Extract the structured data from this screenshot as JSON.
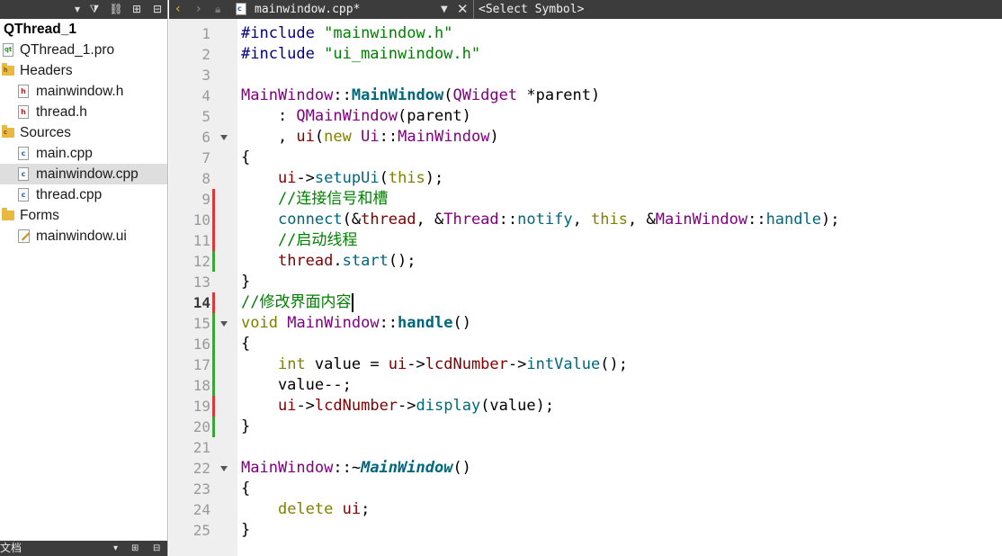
{
  "project_tree": {
    "root": "QThread_1",
    "pro_file": "QThread_1.pro",
    "headers_folder": "Headers",
    "headers": [
      "mainwindow.h",
      "thread.h"
    ],
    "sources_folder": "Sources",
    "sources": [
      "main.cpp",
      "mainwindow.cpp",
      "thread.cpp"
    ],
    "forms_folder": "Forms",
    "forms": [
      "mainwindow.ui"
    ]
  },
  "bottom_panel": {
    "title": "文档"
  },
  "editor_toolbar": {
    "file_tab": "mainwindow.cpp*",
    "symbol_selector": "<Select Symbol>"
  },
  "editor": {
    "current_line": 14,
    "line_numbers": [
      "1",
      "2",
      "3",
      "4",
      "5",
      "6",
      "7",
      "8",
      "9",
      "10",
      "11",
      "12",
      "13",
      "14",
      "15",
      "16",
      "17",
      "18",
      "19",
      "20",
      "21",
      "22",
      "23",
      "24",
      "25"
    ],
    "lines": [
      [
        {
          "t": "#include ",
          "c": "pp"
        },
        {
          "t": "\"mainwindow.h\"",
          "c": "str"
        }
      ],
      [
        {
          "t": "#include ",
          "c": "pp"
        },
        {
          "t": "\"ui_mainwindow.h\"",
          "c": "str"
        }
      ],
      [],
      [
        {
          "t": "MainWindow",
          "c": "cls"
        },
        {
          "t": "::",
          "c": "pl"
        },
        {
          "t": "MainWindow",
          "c": "fdef"
        },
        {
          "t": "(",
          "c": "pl"
        },
        {
          "t": "QWidget",
          "c": "cls"
        },
        {
          "t": " *",
          "c": "pl"
        },
        {
          "t": "parent",
          "c": "pl"
        },
        {
          "t": ")",
          "c": "pl"
        }
      ],
      [
        {
          "t": "    : ",
          "c": "pl"
        },
        {
          "t": "QMainWindow",
          "c": "cls"
        },
        {
          "t": "(parent)",
          "c": "pl"
        }
      ],
      [
        {
          "t": "    , ",
          "c": "pl"
        },
        {
          "t": "ui",
          "c": "mem"
        },
        {
          "t": "(",
          "c": "pl"
        },
        {
          "t": "new",
          "c": "kw"
        },
        {
          "t": " ",
          "c": "pl"
        },
        {
          "t": "Ui",
          "c": "cls"
        },
        {
          "t": "::",
          "c": "pl"
        },
        {
          "t": "MainWindow",
          "c": "cls"
        },
        {
          "t": ")",
          "c": "pl"
        }
      ],
      [
        {
          "t": "{",
          "c": "pl"
        }
      ],
      [
        {
          "t": "    ",
          "c": "pl"
        },
        {
          "t": "ui",
          "c": "mem"
        },
        {
          "t": "->",
          "c": "pl"
        },
        {
          "t": "setupUi",
          "c": "fn"
        },
        {
          "t": "(",
          "c": "pl"
        },
        {
          "t": "this",
          "c": "kw"
        },
        {
          "t": ");",
          "c": "pl"
        }
      ],
      [
        {
          "t": "    //",
          "c": "cmt"
        },
        {
          "t": "连接信号和槽",
          "c": "cmt",
          "cjk": true
        }
      ],
      [
        {
          "t": "    ",
          "c": "pl"
        },
        {
          "t": "connect",
          "c": "fn"
        },
        {
          "t": "(&",
          "c": "pl"
        },
        {
          "t": "thread",
          "c": "mem"
        },
        {
          "t": ", &",
          "c": "pl"
        },
        {
          "t": "Thread",
          "c": "cls"
        },
        {
          "t": "::",
          "c": "pl"
        },
        {
          "t": "notify",
          "c": "fn"
        },
        {
          "t": ", ",
          "c": "pl"
        },
        {
          "t": "this",
          "c": "kw"
        },
        {
          "t": ", &",
          "c": "pl"
        },
        {
          "t": "MainWindow",
          "c": "cls"
        },
        {
          "t": "::",
          "c": "pl"
        },
        {
          "t": "handle",
          "c": "fn"
        },
        {
          "t": ");",
          "c": "pl"
        }
      ],
      [
        {
          "t": "    //",
          "c": "cmt"
        },
        {
          "t": "启动线程",
          "c": "cmt",
          "cjk": true
        }
      ],
      [
        {
          "t": "    ",
          "c": "pl"
        },
        {
          "t": "thread",
          "c": "mem"
        },
        {
          "t": ".",
          "c": "pl"
        },
        {
          "t": "start",
          "c": "fn"
        },
        {
          "t": "();",
          "c": "pl"
        }
      ],
      [
        {
          "t": "}",
          "c": "pl"
        }
      ],
      [
        {
          "t": "//",
          "c": "cmt"
        },
        {
          "t": "修改界面内容",
          "c": "cmt",
          "cjk": true
        }
      ],
      [
        {
          "t": "void",
          "c": "kw"
        },
        {
          "t": " ",
          "c": "pl"
        },
        {
          "t": "MainWindow",
          "c": "cls"
        },
        {
          "t": "::",
          "c": "pl"
        },
        {
          "t": "handle",
          "c": "fdef"
        },
        {
          "t": "()",
          "c": "pl"
        }
      ],
      [
        {
          "t": "{",
          "c": "pl"
        }
      ],
      [
        {
          "t": "    ",
          "c": "pl"
        },
        {
          "t": "int",
          "c": "kw"
        },
        {
          "t": " value = ",
          "c": "pl"
        },
        {
          "t": "ui",
          "c": "mem"
        },
        {
          "t": "->",
          "c": "pl"
        },
        {
          "t": "lcdNumber",
          "c": "mem"
        },
        {
          "t": "->",
          "c": "pl"
        },
        {
          "t": "intValue",
          "c": "fn"
        },
        {
          "t": "();",
          "c": "pl"
        }
      ],
      [
        {
          "t": "    value--;",
          "c": "pl"
        }
      ],
      [
        {
          "t": "    ",
          "c": "pl"
        },
        {
          "t": "ui",
          "c": "mem"
        },
        {
          "t": "->",
          "c": "pl"
        },
        {
          "t": "lcdNumber",
          "c": "mem"
        },
        {
          "t": "->",
          "c": "pl"
        },
        {
          "t": "display",
          "c": "fn"
        },
        {
          "t": "(value);",
          "c": "pl"
        }
      ],
      [
        {
          "t": "}",
          "c": "pl"
        }
      ],
      [],
      [
        {
          "t": "MainWindow",
          "c": "cls"
        },
        {
          "t": "::~",
          "c": "pl"
        },
        {
          "t": "MainWindow",
          "c": "fdefi"
        },
        {
          "t": "()",
          "c": "pl"
        }
      ],
      [
        {
          "t": "{",
          "c": "pl"
        }
      ],
      [
        {
          "t": "    ",
          "c": "pl"
        },
        {
          "t": "delete",
          "c": "kw"
        },
        {
          "t": " ",
          "c": "pl"
        },
        {
          "t": "ui",
          "c": "mem"
        },
        {
          "t": ";",
          "c": "pl"
        }
      ],
      [
        {
          "t": "}",
          "c": "pl"
        }
      ]
    ],
    "fold_lines": [
      6,
      15,
      22
    ],
    "modified_lines": [
      9,
      10,
      11,
      14,
      19
    ],
    "added_lines": [
      12,
      15,
      16,
      17,
      18,
      20
    ]
  }
}
